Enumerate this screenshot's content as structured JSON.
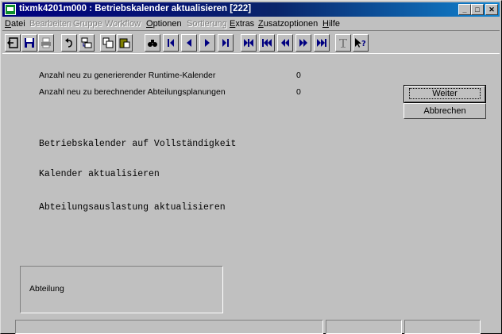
{
  "window": {
    "title": "tixmk4201m000 : Betriebskalender aktualisieren [222]",
    "controls": {
      "minimize": "_",
      "maximize": "□",
      "close": "✕"
    }
  },
  "menu": [
    {
      "label": "Datei",
      "enabled": true
    },
    {
      "label": "Bearbeiten",
      "enabled": false
    },
    {
      "label": "Gruppe",
      "enabled": false
    },
    {
      "label": "Workflow",
      "enabled": false
    },
    {
      "label": "Optionen",
      "enabled": true
    },
    {
      "label": "Sortierung",
      "enabled": false
    },
    {
      "label": "Extras",
      "enabled": true
    },
    {
      "label": "Zusatzoptionen",
      "enabled": true
    },
    {
      "label": "Hilfe",
      "enabled": true
    }
  ],
  "toolbar": {
    "icons": [
      "exit-icon",
      "save-icon",
      "print-icon",
      "undo-icon",
      "insert-icon",
      "copy-icon",
      "paste-icon",
      "find-icon",
      "first-record-icon",
      "previous-record-icon",
      "next-record-icon",
      "last-record-icon",
      "first-set-icon",
      "previous-set-icon",
      "previous-page-icon",
      "next-page-icon",
      "last-page-icon",
      "text-icon",
      "help-pointer-icon"
    ]
  },
  "form": {
    "runtime_label": "Anzahl neu zu generierender Runtime-Kalender",
    "runtime_value": "0",
    "abteilung_label": "Anzahl neu zu berechnender Abteilungsplanungen",
    "abteilung_value": "0",
    "step1": "Betriebskalender auf Vollständigkeit",
    "step2": "Kalender aktualisieren",
    "step3": "Abteilungsauslastung aktualisieren",
    "group_label": "Abteilung"
  },
  "buttons": {
    "continue": "Weiter",
    "cancel": "Abbrechen"
  },
  "status": [
    "",
    "",
    ""
  ]
}
